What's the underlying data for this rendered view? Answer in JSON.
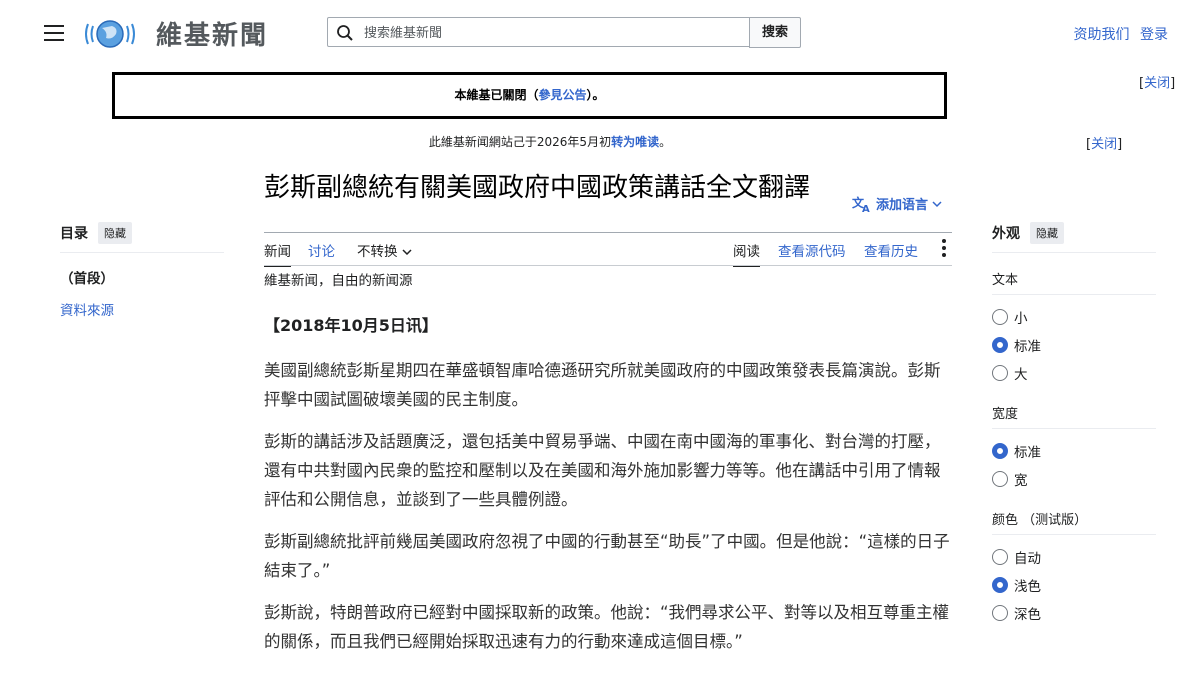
{
  "header": {
    "wordmark": "維基新聞",
    "search_placeholder": "搜索維基新聞",
    "search_button": "搜索",
    "donate": "资助我们",
    "login": "登录"
  },
  "notices": {
    "site_notice_prefix": "本維基已關閉（",
    "site_notice_link": "參見公告",
    "site_notice_suffix": "）。",
    "close_label": "关闭",
    "notice2_prefix": "此維基新闻網站己于2026年5月初",
    "notice2_link": "转为唯读",
    "notice2_suffix": "。"
  },
  "article": {
    "title": "彭斯副總統有關美國政府中國政策講話全文翻譯",
    "add_language": "添加语言",
    "tabs_left": [
      "新闻",
      "讨论",
      "不转换"
    ],
    "tabs_right": [
      "阅读",
      "查看源代码",
      "查看历史"
    ],
    "tagline": "維基新闻，自由的新闻源",
    "dateline": "【2018年10月5日讯】",
    "paragraphs": [
      "美國副總統彭斯星期四在華盛頓智庫哈德遜研究所就美國政府的中國政策發表長篇演說。彭斯抨擊中國試圖破壞美國的民主制度。",
      "彭斯的講話涉及話題廣泛，還包括美中貿易爭端、中國在南中國海的軍事化、對台灣的打壓，還有中共對國內民衆的監控和壓制以及在美國和海外施加影響力等等。他在講話中引用了情報評估和公開信息，並談到了一些具體例證。",
      "彭斯副總統批評前幾屆美國政府忽視了中國的行動甚至“助長”了中國。但是他說：“這樣的日子結束了。”",
      "彭斯說，特朗普政府已經對中國採取新的政策。他說：“我們尋求公平、對等以及相互尊重主權的關係，而且我們已經開始採取迅速有力的行動來達成這個目標。”"
    ]
  },
  "toc": {
    "heading": "目录",
    "hide": "隐藏",
    "items": [
      "（首段）",
      "資料來源"
    ]
  },
  "appearance": {
    "heading": "外观",
    "hide": "隐藏",
    "text_label": "文本",
    "text_options": [
      "小",
      "标准",
      "大"
    ],
    "width_label": "宽度",
    "width_options": [
      "标准",
      "宽"
    ],
    "color_label": "颜色 （测试版）",
    "color_options": [
      "自动",
      "浅色",
      "深色"
    ]
  },
  "colors": {
    "link": "#3366cc",
    "selected_radio": "#3366cc"
  }
}
